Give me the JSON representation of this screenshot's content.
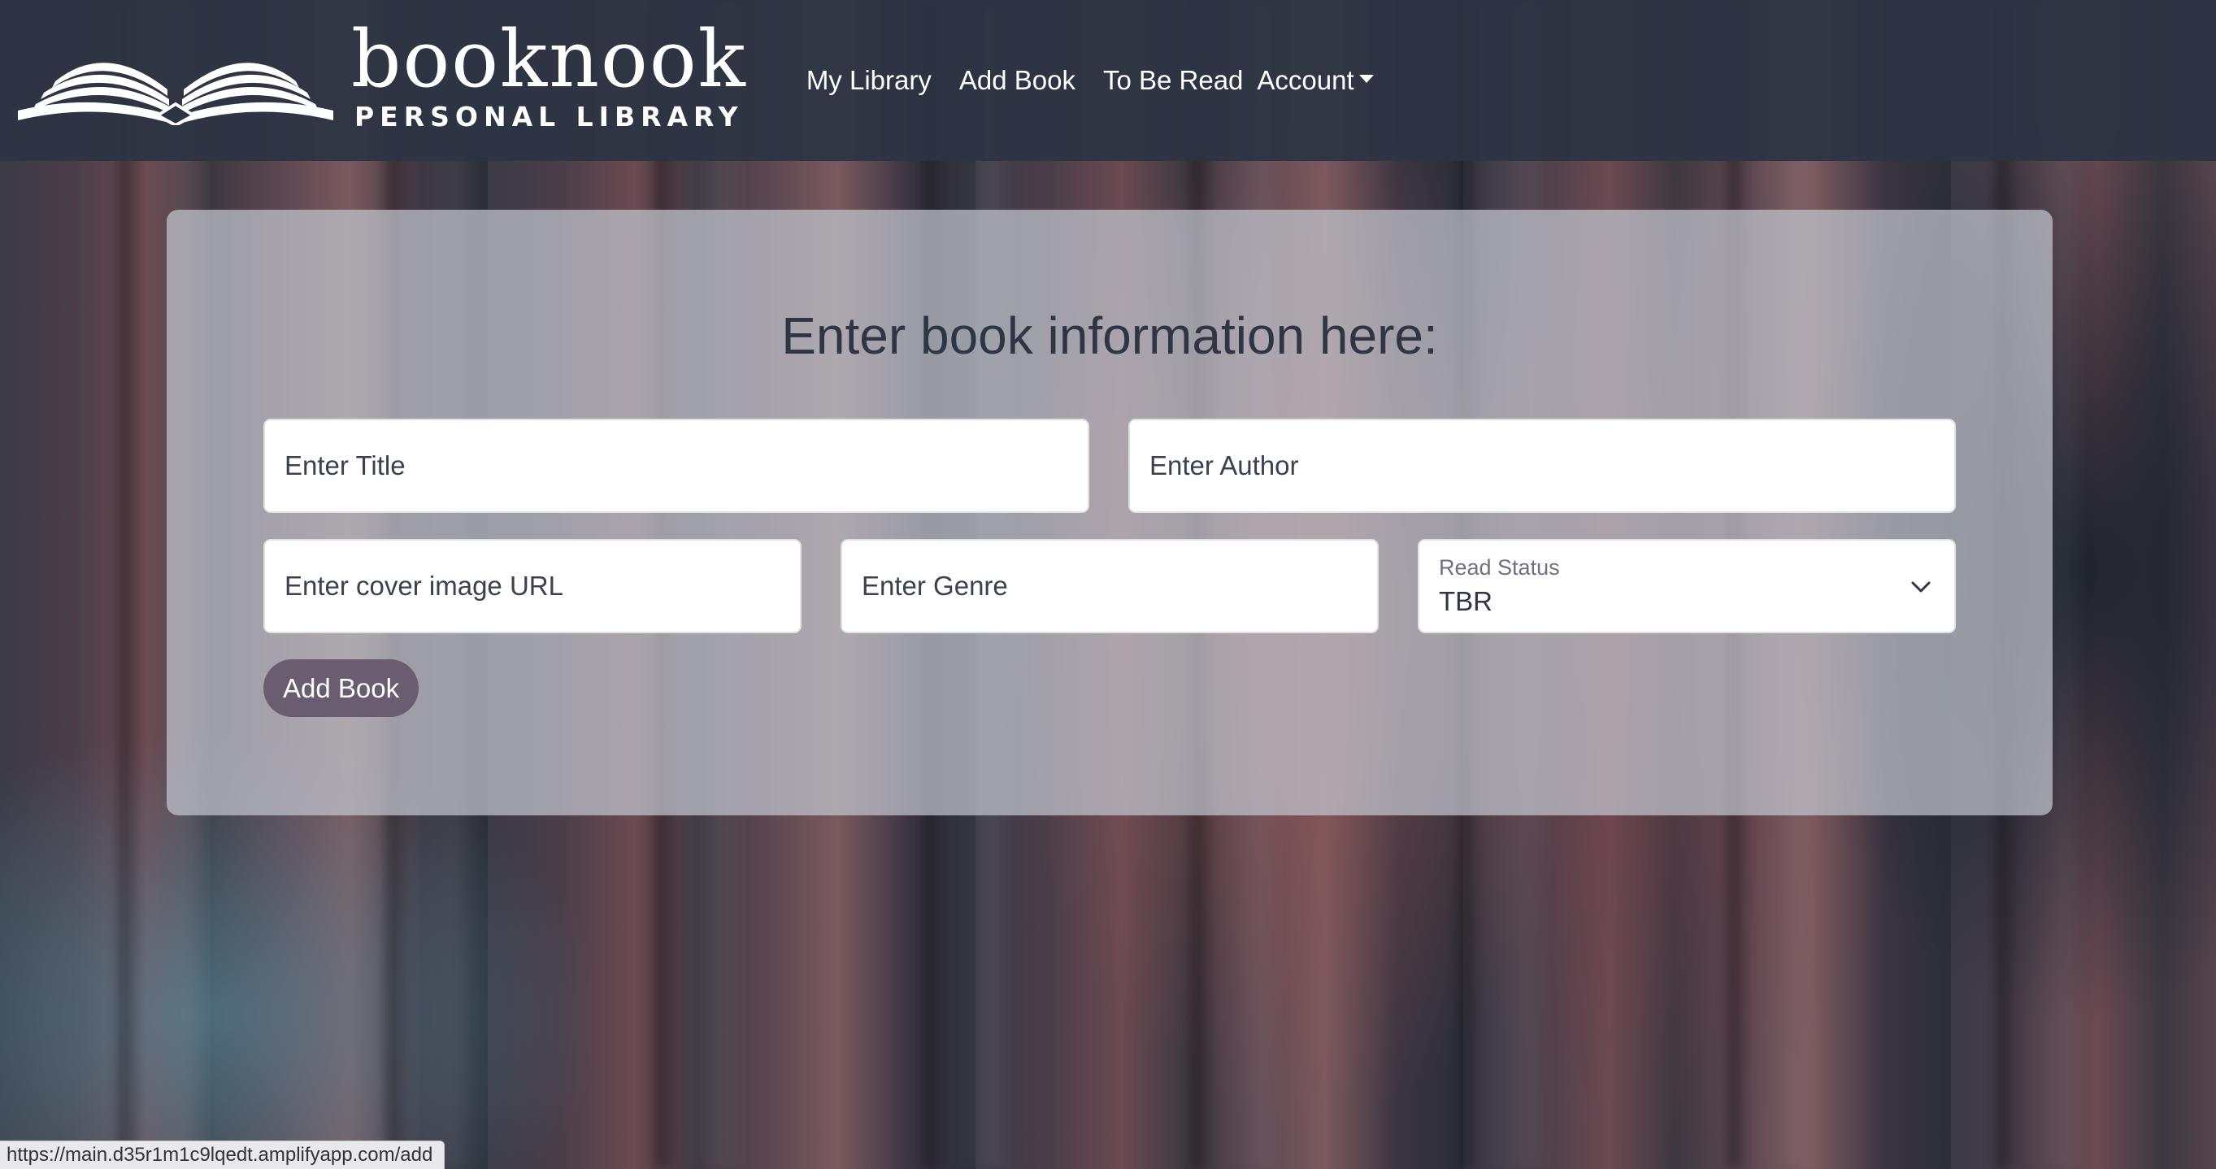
{
  "brand": {
    "name": "booknook",
    "subtitle": "PERSONAL LIBRARY"
  },
  "nav": {
    "items": [
      {
        "label": "My Library"
      },
      {
        "label": "Add Book"
      },
      {
        "label": "To Be Read"
      },
      {
        "label": "Account"
      }
    ]
  },
  "form": {
    "heading": "Enter book information here:",
    "title_placeholder": "Enter Title",
    "author_placeholder": "Enter Author",
    "cover_placeholder": "Enter cover image URL",
    "genre_placeholder": "Enter Genre",
    "read_status": {
      "label": "Read Status",
      "value": "TBR"
    },
    "submit_label": "Add Book"
  },
  "status_bar": {
    "url": "https://main.d35r1m1c9lqedt.amplifyapp.com/add"
  },
  "colors": {
    "navbar": "#2c3443",
    "button": "#6a5d6f",
    "heading_text": "#2e3645"
  },
  "icons": {
    "logo": "open-book-icon",
    "account_caret": "caret-down-icon",
    "select": "chevron-down-icon"
  }
}
